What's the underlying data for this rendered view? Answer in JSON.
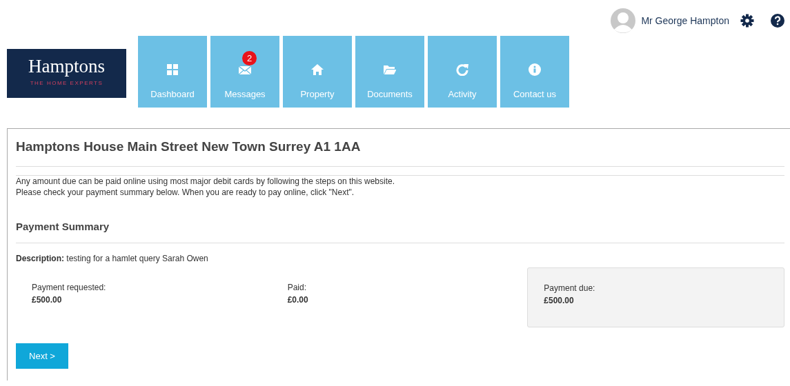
{
  "user": {
    "name": "Mr George Hampton"
  },
  "logo": {
    "name": "Hamptons",
    "tagline": "THE HOME EXPERTS"
  },
  "nav": [
    {
      "label": "Dashboard"
    },
    {
      "label": "Messages",
      "badge": "2"
    },
    {
      "label": "Property"
    },
    {
      "label": "Documents"
    },
    {
      "label": "Activity"
    },
    {
      "label": "Contact us"
    }
  ],
  "panel": {
    "title": "Hamptons House Main Street New Town Surrey A1 1AA",
    "intro": [
      "Any amount due can be paid online using most major debit cards by following the steps on this website.",
      "Please check your payment summary below. When you are ready to pay online, click \"Next\"."
    ],
    "summary_heading": "Payment Summary",
    "description": "**Description:** testing for a hamlet query Sarah Owen",
    "amounts": [
      {
        "label": "Payment requested:",
        "value": "£500.00",
        "highlighted": false
      },
      {
        "label": "Paid:",
        "value": "£0.00",
        "highlighted": false
      },
      {
        "label": "Payment due:",
        "value": "£500.00",
        "highlighted": true
      }
    ],
    "next_button": "Next >"
  }
}
